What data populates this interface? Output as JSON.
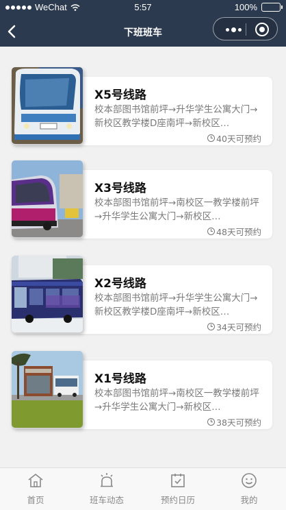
{
  "status_bar": {
    "carrier": "WeChat",
    "time": "5:57",
    "battery": "100%"
  },
  "nav": {
    "title": "下班班车",
    "back_icon": "chevron-left-icon",
    "more_icon": "more-dots-icon",
    "close_icon": "target-circle-icon"
  },
  "routes": [
    {
      "name": "X5号线路",
      "route": "校本部图书馆前坪→升华学生公寓大门→新校区教学楼D座南坪→新校区…",
      "availability": "40天可预约",
      "image": "bus-photo-white-coach"
    },
    {
      "name": "X3号线路",
      "route": "校本部图书馆前坪→南校区一教学楼前坪→升华学生公寓大门→新校区…",
      "availability": "48天可预约",
      "image": "bus-photo-purple-coach"
    },
    {
      "name": "X2号线路",
      "route": "校本部图书馆前坪→升华学生公寓大门→新校区教学楼D座南坪→新校区…",
      "availability": "34天可预约",
      "image": "bus-photo-blue-city-bus"
    },
    {
      "name": "X1号线路",
      "route": "校本部图书馆前坪→南校区一教学楼前坪→升华学生公寓大门→新校区…",
      "availability": "38天可预约",
      "image": "bus-photo-campus-stop"
    }
  ],
  "tabbar": [
    {
      "label": "首页",
      "icon": "home-icon"
    },
    {
      "label": "班车动态",
      "icon": "alarm-light-icon"
    },
    {
      "label": "预约日历",
      "icon": "calendar-check-icon"
    },
    {
      "label": "我的",
      "icon": "smiley-icon"
    }
  ],
  "colors": {
    "nav_bg": "#2c3a4f",
    "page_bg": "#f1f1f1",
    "tab_text": "#888888"
  }
}
